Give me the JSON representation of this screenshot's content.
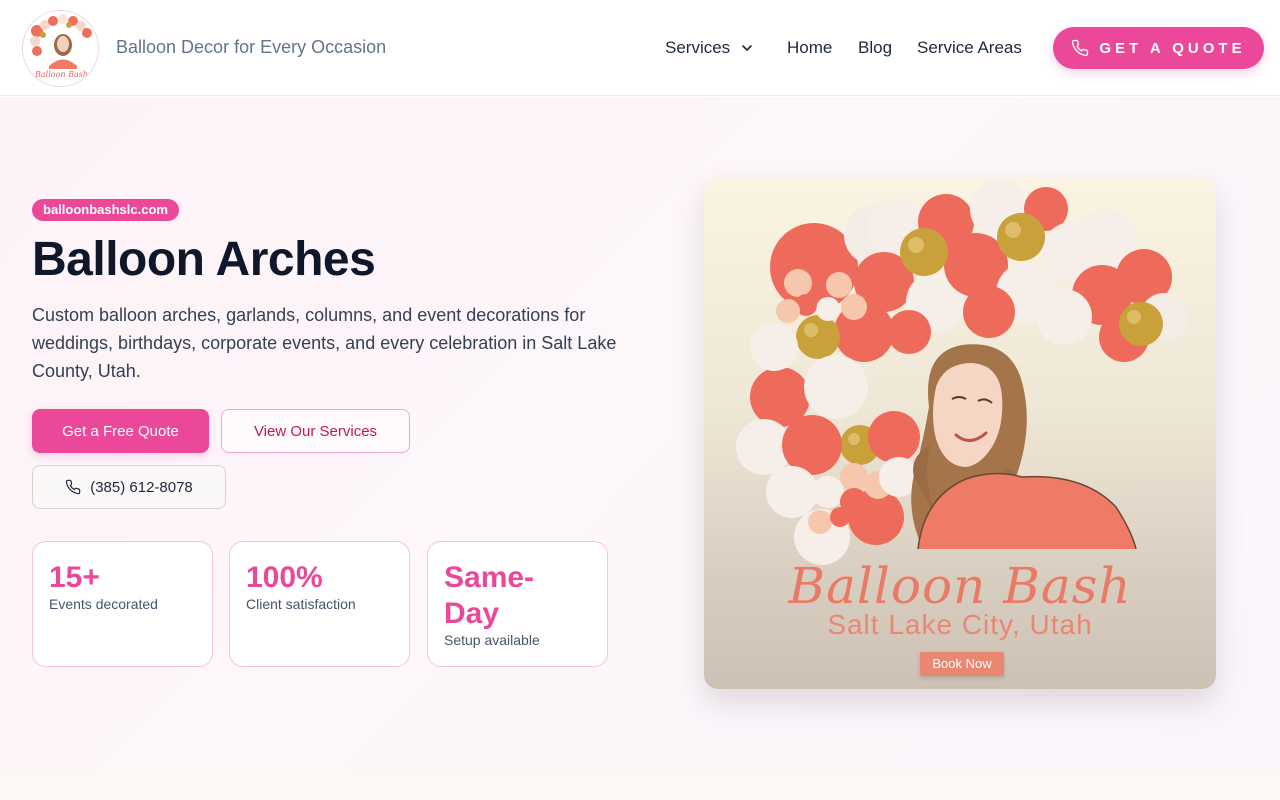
{
  "header": {
    "tagline": "Balloon Decor for Every Occasion",
    "logo_text": "Balloon Bash",
    "nav": {
      "services": "Services",
      "home": "Home",
      "blog": "Blog",
      "service_areas": "Service Areas"
    },
    "quote_button": "GET A QUOTE"
  },
  "hero": {
    "badge": "balloonbashslc.com",
    "title": "Balloon Arches",
    "description": "Custom balloon arches, garlands, columns, and event decorations for weddings, birthdays, corporate events, and every celebration in Salt Lake County, Utah.",
    "primary_button": "Get a Free Quote",
    "secondary_button": "View Our Services",
    "phone_button": "(385) 612-8078",
    "stats": [
      {
        "value": "15+",
        "label": "Events decorated"
      },
      {
        "value": "100%",
        "label": "Client satisfaction"
      },
      {
        "value": "Same-Day",
        "label": "Setup available"
      }
    ]
  },
  "promo": {
    "brand": "Balloon Bash",
    "city": "Salt Lake City, Utah",
    "book_button": "Book Now"
  },
  "colors": {
    "accent": "#ec4899",
    "coral": "#ea7a66",
    "gold": "#c9a13b"
  },
  "icons": {
    "phone": "phone-icon",
    "chevron": "chevron-down-icon"
  }
}
